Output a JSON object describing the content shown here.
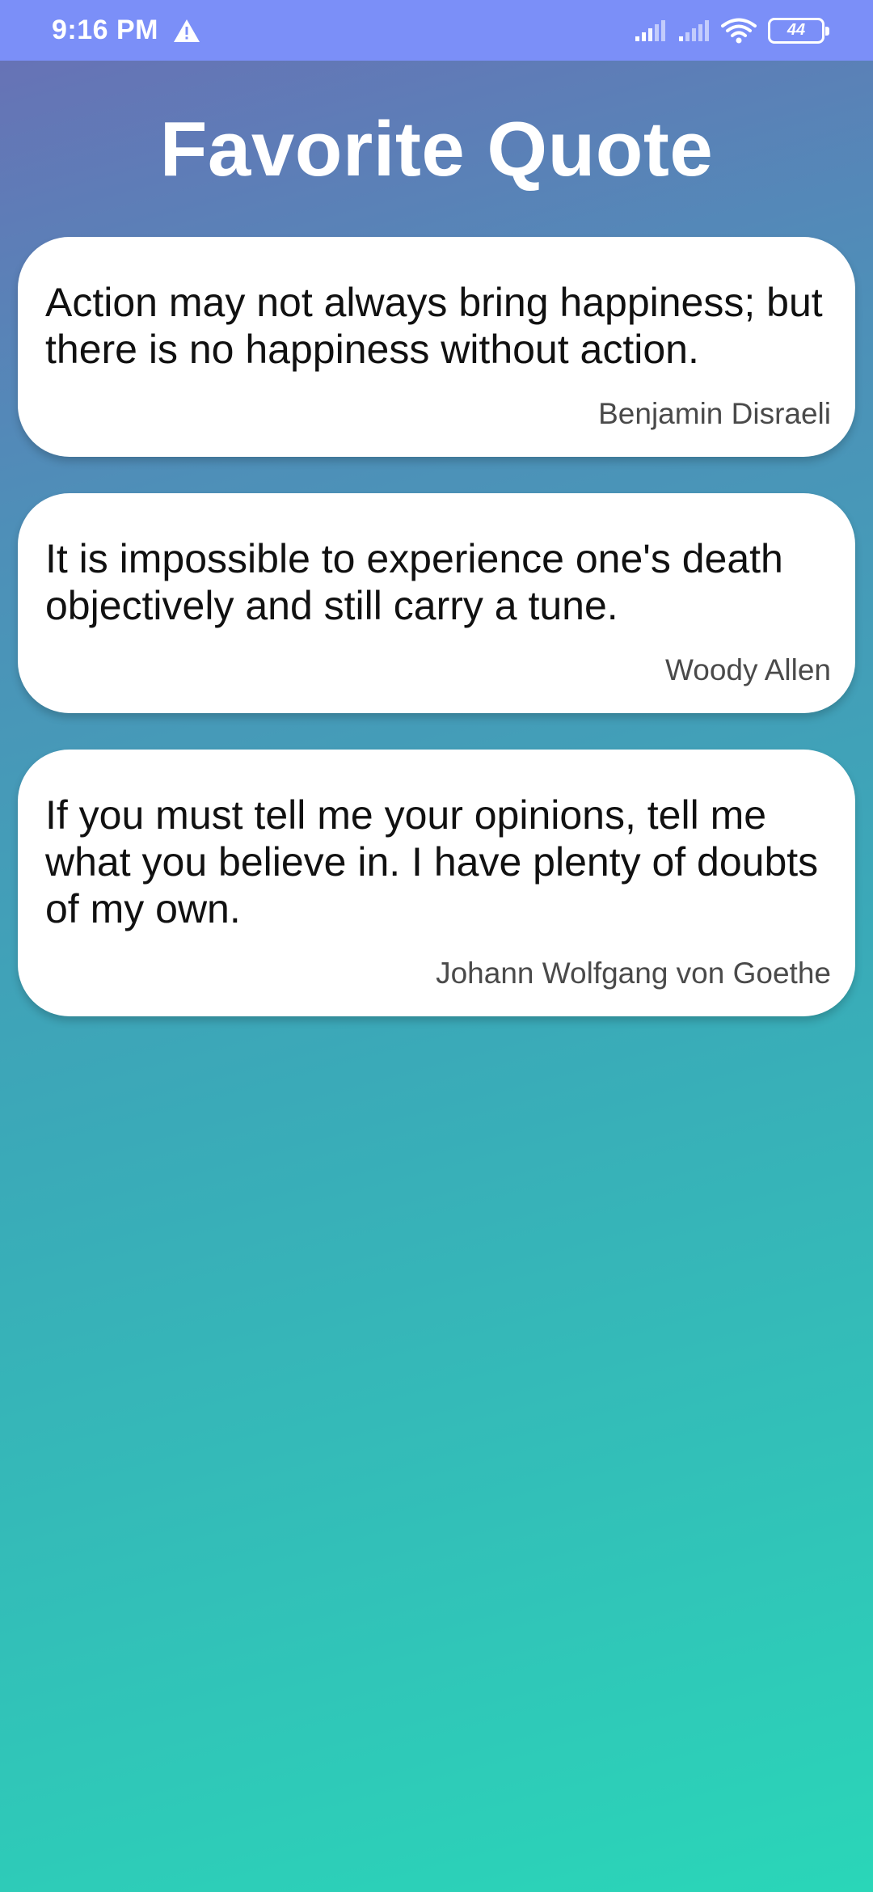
{
  "status_bar": {
    "time": "9:16 PM",
    "alert_icon": "warning-triangle-icon",
    "battery_level": "44"
  },
  "page": {
    "title": "Favorite Quote"
  },
  "quotes": [
    {
      "text": "Action may not always bring happiness; but there is no happiness without action.",
      "author": "Benjamin Disraeli"
    },
    {
      "text": "It is impossible to experience one's death objectively and still carry a tune.",
      "author": "Woody Allen"
    },
    {
      "text": "If you must tell me your opinions, tell me what you believe in. I have plenty of doubts of my own.",
      "author": "Johann Wolfgang von Goethe"
    }
  ],
  "colors": {
    "status_bar": "#7b8ff8",
    "gradient_top": "#6a6fb6",
    "gradient_bottom": "#2ad6b8",
    "card": "#ffffff"
  }
}
